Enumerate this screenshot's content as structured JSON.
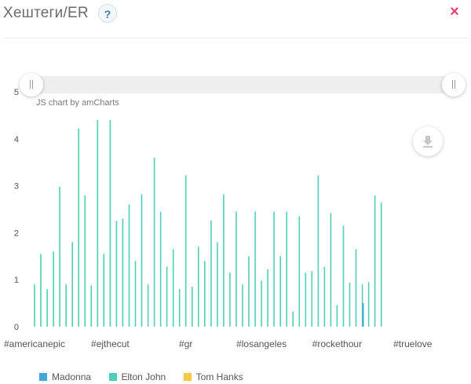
{
  "header": {
    "title": "Хештеги/ER",
    "help_label": "?",
    "close_label": "×"
  },
  "credit": "JS chart by amCharts",
  "chart_data": {
    "type": "bar",
    "title": "",
    "xlabel": "",
    "ylabel": "",
    "ylim": [
      0,
      5
    ],
    "yticks": [
      0,
      1,
      2,
      3,
      4,
      5
    ],
    "grid": false,
    "legend_position": "bottom",
    "x_tick_labels": [
      {
        "index": 0,
        "label": "#americanepic"
      },
      {
        "index": 12,
        "label": "#ejthecut"
      },
      {
        "index": 24,
        "label": "#gr"
      },
      {
        "index": 36,
        "label": "#losangeles"
      },
      {
        "index": 48,
        "label": "#rockethour"
      },
      {
        "index": 60,
        "label": "#truelove"
      }
    ],
    "categories_count": 67,
    "series": [
      {
        "name": "Madonna",
        "color": "#42A6DB",
        "values": []
      },
      {
        "name": "Elton John",
        "color": "#4CD1B6",
        "values": [
          0.9,
          1.55,
          0.8,
          1.6,
          2.98,
          0.9,
          1.8,
          4.22,
          2.8,
          0.88,
          4.4,
          1.55,
          4.4,
          2.25,
          2.3,
          2.6,
          1.4,
          2.82,
          0.9,
          3.6,
          2.45,
          1.28,
          1.65,
          0.8,
          3.22,
          0.85,
          1.7,
          1.4,
          2.26,
          1.8,
          2.82,
          1.15,
          2.45,
          0.9,
          1.5,
          2.45,
          0.98,
          1.22,
          2.45,
          1.5,
          2.45,
          0.32,
          2.35,
          1.15,
          1.18,
          3.22,
          1.28,
          2.42,
          0.46,
          2.15,
          0.94,
          1.65,
          0.9,
          0.95,
          2.8,
          2.64
        ]
      },
      {
        "name": "Tom Hanks",
        "color": "#F5CA48",
        "values": []
      }
    ],
    "highlight": {
      "index": 52,
      "value": 0.5,
      "color": "#42A6DB"
    }
  }
}
